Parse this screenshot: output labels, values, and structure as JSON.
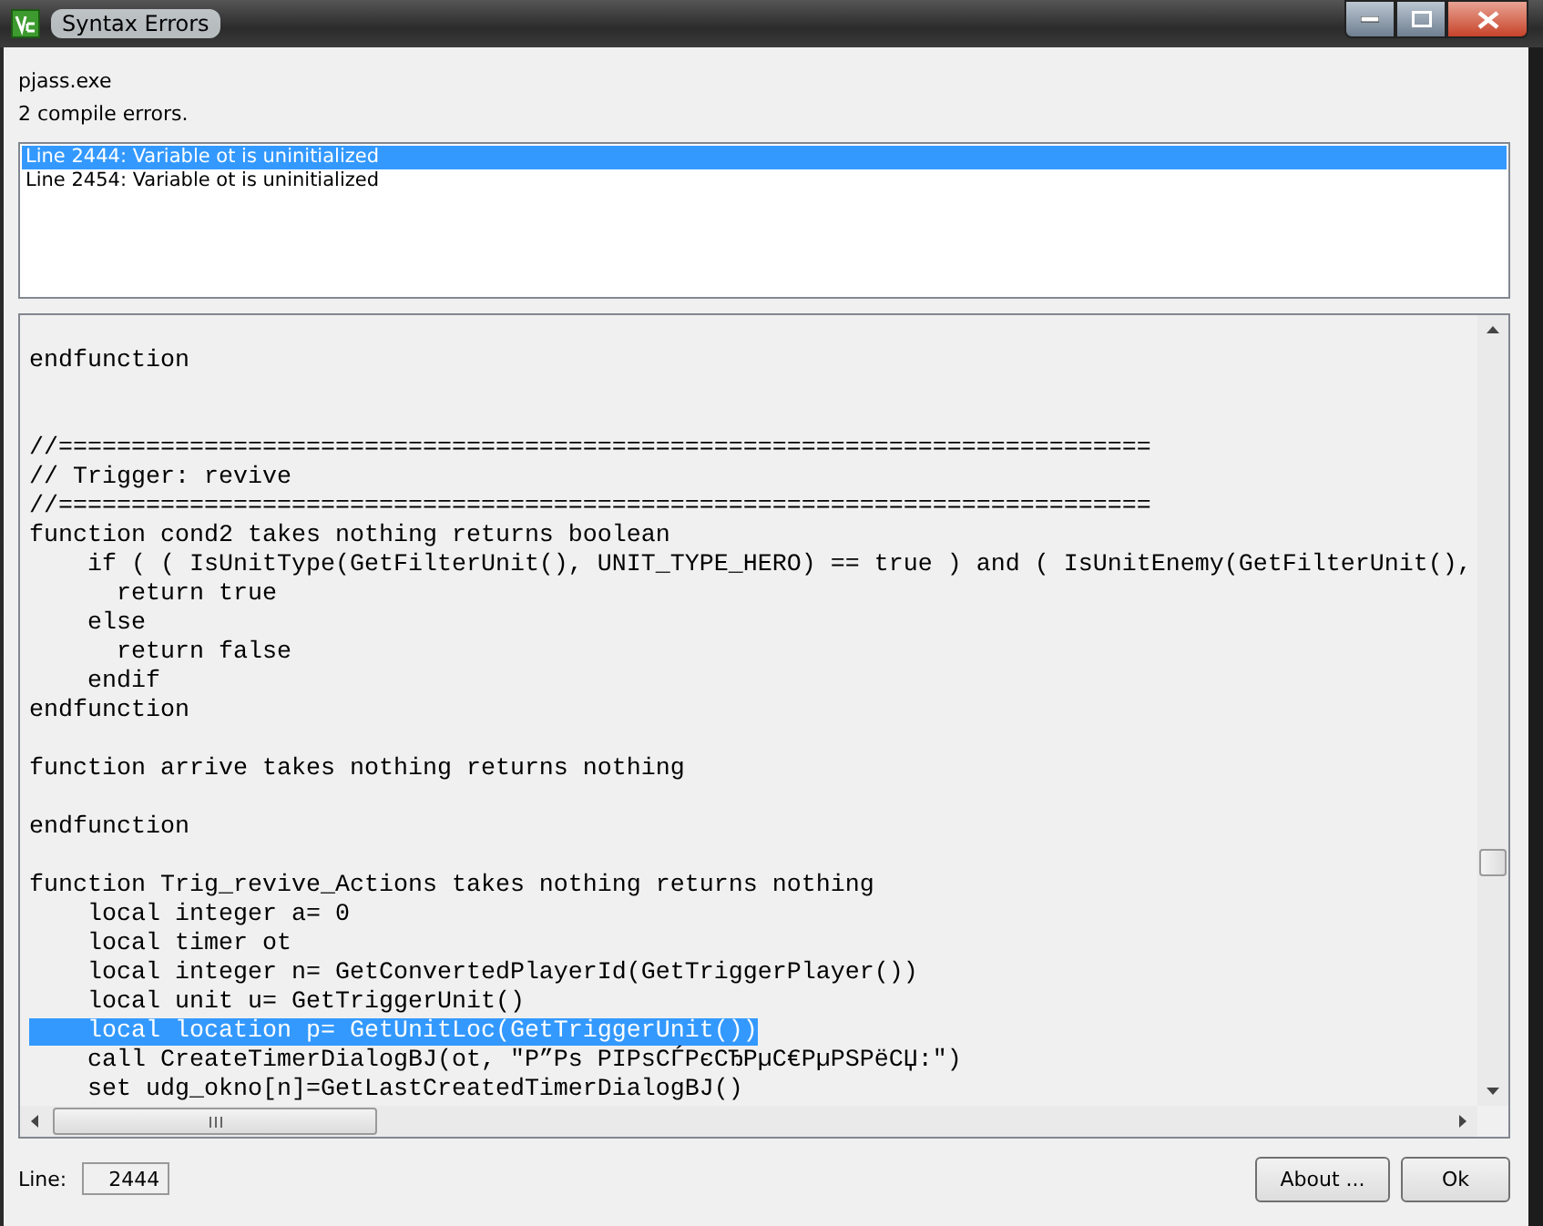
{
  "window": {
    "title": "Syntax Errors"
  },
  "tool": "pjass.exe",
  "summary": "2 compile errors.",
  "errors": [
    {
      "text": "Line 2444:  Variable ot is uninitialized",
      "selected": true
    },
    {
      "text": "Line 2454:  Variable ot is uninitialized",
      "selected": false
    }
  ],
  "code": {
    "lines": [
      {
        "kind": "blank"
      },
      {
        "kind": "code",
        "text": "endfunction",
        "selected": false
      },
      {
        "kind": "blank"
      },
      {
        "kind": "blank"
      },
      {
        "kind": "code",
        "text": "//===========================================================================",
        "selected": false
      },
      {
        "kind": "code",
        "text": "// Trigger: revive",
        "selected": false
      },
      {
        "kind": "code",
        "text": "//===========================================================================",
        "selected": false
      },
      {
        "kind": "code",
        "text": "function cond2 takes nothing returns boolean",
        "selected": false
      },
      {
        "kind": "code",
        "text": "    if ( ( IsUnitType(GetFilterUnit(), UNIT_TYPE_HERO) == true ) and ( IsUnitEnemy(GetFilterUnit(),",
        "selected": false
      },
      {
        "kind": "code",
        "text": "      return true",
        "selected": false
      },
      {
        "kind": "code",
        "text": "    else",
        "selected": false
      },
      {
        "kind": "code",
        "text": "      return false",
        "selected": false
      },
      {
        "kind": "code",
        "text": "    endif",
        "selected": false
      },
      {
        "kind": "code",
        "text": "endfunction",
        "selected": false
      },
      {
        "kind": "blank"
      },
      {
        "kind": "code",
        "text": "function arrive takes nothing returns nothing",
        "selected": false
      },
      {
        "kind": "blank"
      },
      {
        "kind": "code",
        "text": "endfunction",
        "selected": false
      },
      {
        "kind": "blank"
      },
      {
        "kind": "code",
        "text": "function Trig_revive_Actions takes nothing returns nothing",
        "selected": false
      },
      {
        "kind": "code",
        "text": "    local integer a= 0",
        "selected": false
      },
      {
        "kind": "code",
        "text": "    local timer ot",
        "selected": false
      },
      {
        "kind": "code",
        "text": "    local integer n= GetConvertedPlayerId(GetTriggerPlayer())",
        "selected": false
      },
      {
        "kind": "code",
        "text": "    local unit u= GetTriggerUnit()",
        "selected": false
      },
      {
        "kind": "code",
        "text": "    local location p= GetUnitLoc(GetTriggerUnit())",
        "selected": true
      },
      {
        "kind": "code",
        "text": "    call CreateTimerDialogBJ(ot, \"Р”Рѕ РІРѕСЃРєСЂРµС€РµРЅРёСЏ:\")",
        "selected": false
      },
      {
        "kind": "code",
        "text": "    set udg_okno[n]=GetLastCreatedTimerDialogBJ()",
        "selected": false
      }
    ]
  },
  "line_field": {
    "label": "Line:",
    "value": "2444"
  },
  "buttons": [
    "About ...",
    "Ok"
  ]
}
